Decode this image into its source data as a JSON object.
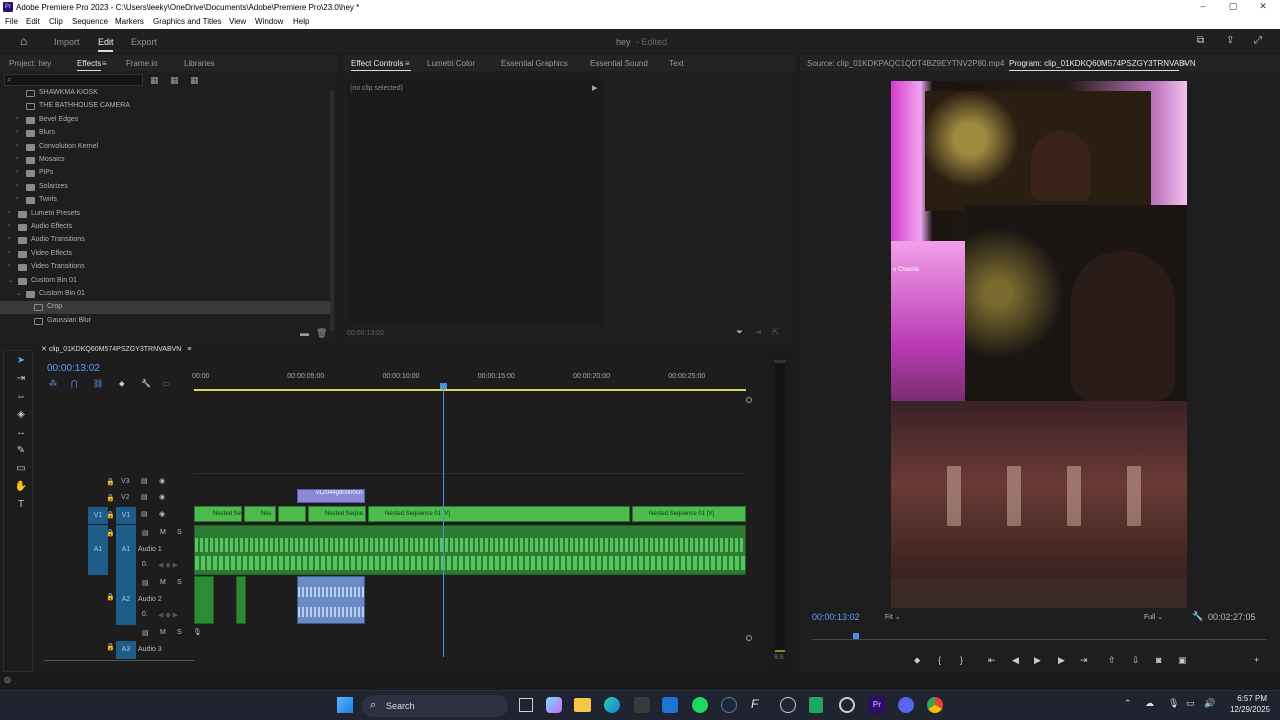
{
  "window": {
    "title": "Adobe Premiere Pro 2023 - C:\\Users\\leeky\\OneDrive\\Documents\\Adobe\\Premiere Pro\\23.0\\hey *",
    "logo": "Pr"
  },
  "menu": [
    "File",
    "Edit",
    "Clip",
    "Sequence",
    "Markers",
    "Graphics and Titles",
    "View",
    "Window",
    "Help"
  ],
  "workspace": {
    "tabs": [
      "Import",
      "Edit",
      "Export"
    ],
    "active": "Edit",
    "project": "hey",
    "status": "- Edited"
  },
  "project_panel": {
    "tabs": [
      "Project: hey",
      "Effects",
      "Frame.io",
      "Libraries"
    ],
    "active": "Effects",
    "items": [
      {
        "label": "SHAWKMA KIOSK",
        "indent": 1,
        "type": "preset"
      },
      {
        "label": "THE BATHHOUSE CAMERA",
        "indent": 1,
        "type": "preset"
      },
      {
        "label": "Bevel Edges",
        "indent": 1,
        "type": "folder"
      },
      {
        "label": "Blurs",
        "indent": 1,
        "type": "folder"
      },
      {
        "label": "Convolution Kernel",
        "indent": 1,
        "type": "folder"
      },
      {
        "label": "Mosaics",
        "indent": 1,
        "type": "folder"
      },
      {
        "label": "PiPs",
        "indent": 1,
        "type": "folder"
      },
      {
        "label": "Solarizes",
        "indent": 1,
        "type": "folder"
      },
      {
        "label": "Twirls",
        "indent": 1,
        "type": "folder"
      },
      {
        "label": "Lumetri Presets",
        "indent": 0,
        "type": "folder"
      },
      {
        "label": "Audio Effects",
        "indent": 0,
        "type": "folder"
      },
      {
        "label": "Audio Transitions",
        "indent": 0,
        "type": "folder"
      },
      {
        "label": "Video Effects",
        "indent": 0,
        "type": "folder"
      },
      {
        "label": "Video Transitions",
        "indent": 0,
        "type": "folder"
      },
      {
        "label": "Custom Bin 01",
        "indent": 0,
        "type": "folder-open"
      },
      {
        "label": "Custom Bin 01",
        "indent": 1,
        "type": "folder-open"
      },
      {
        "label": "Crop",
        "indent": 2,
        "type": "effect",
        "selected": true
      },
      {
        "label": "Gaussian Blur",
        "indent": 2,
        "type": "effect"
      }
    ]
  },
  "effect_controls": {
    "tabs": [
      "Effect Controls",
      "Lumetri Color",
      "Essential Graphics",
      "Essential Sound",
      "Text"
    ],
    "active": "Effect Controls",
    "empty": "(no clip selected)",
    "timecode": "00:00:13:02"
  },
  "source_monitor": {
    "label": "Source: clip_01KDKPAQC1QDT4BZ9EYTNV2P80.mp4"
  },
  "program_monitor": {
    "label": "Program: clip_01KDKQ60M574PSZGY3TRNVABVN",
    "timecode": "00:00:13:02",
    "fit": "Fit",
    "quality": "Full",
    "duration": "00:02:27:05",
    "playhead_fraction": 0.09,
    "overlay_text": "u Channe"
  },
  "timeline": {
    "tab": "clip_01KDKQ60M574PSZGY3TRNVABVN",
    "timecode": "00:00:13:02",
    "ruler": [
      "00:00",
      "00:00:05:00",
      "00:00:10:00",
      "00:00:15:00",
      "00:00:20:00",
      "00:00:25:00"
    ],
    "playhead_seconds": 13.08,
    "tracks": {
      "v3": "V3",
      "v2": "V2",
      "v1": "V1",
      "a1": "A1",
      "a2": "A2",
      "a3": "A3",
      "a1_name": "Audio 1",
      "a2_name": "Audio 2",
      "a3_name": "Audio 3",
      "src_v1": "V1",
      "src_a1": "A1",
      "m": "M",
      "s": "S",
      "zero": "0."
    },
    "clips": {
      "v2_clip": "v12044gd0000cn",
      "v1_a": "Nested Se",
      "v1_b": "Nes",
      "v1_c": "Nested Seque",
      "v1_d": "Nested Sequence 01 [V]",
      "v1_e": "Nested Sequence 01 [V]"
    },
    "meter_label": "S S"
  },
  "taskbar": {
    "search": "Search",
    "time": "6:57 PM",
    "date": "12/29/2025"
  }
}
